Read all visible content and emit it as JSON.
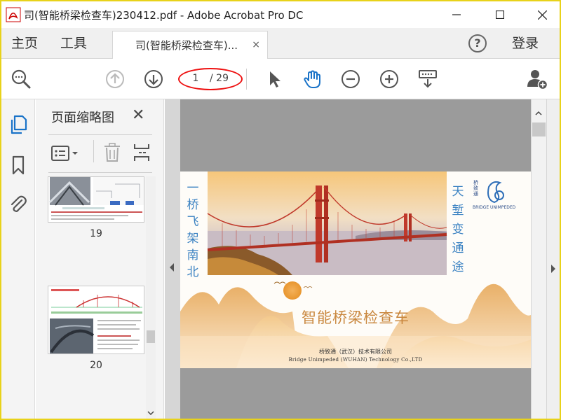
{
  "window": {
    "title": "司(智能桥梁检查车)230412.pdf - Adobe Acrobat Pro DC",
    "minimize_icon": "minimize-icon",
    "maximize_icon": "maximize-icon",
    "close_icon": "close-icon"
  },
  "tabs": {
    "home_label": "主页",
    "tools_label": "工具",
    "document_tab_label": "司(智能桥梁检查车)...",
    "document_tab_close": "×",
    "help_label": "?",
    "login_label": "登录"
  },
  "toolbar": {
    "page_current": "1",
    "page_total": "/ 29",
    "icons": [
      "zoom-search-icon",
      "page-up-icon",
      "page-down-icon",
      "select-cursor-icon",
      "hand-tool-icon",
      "zoom-out-icon",
      "zoom-in-icon",
      "read-mode-icon",
      "add-user-icon"
    ]
  },
  "left_rail": {
    "icons": [
      "page-thumbnails-icon",
      "bookmark-icon",
      "attachment-icon"
    ]
  },
  "thumbnail_panel": {
    "title": "页面缩略图",
    "close": "✕",
    "thumbnails": [
      {
        "page_label": "19"
      },
      {
        "page_label": "20"
      }
    ]
  },
  "document": {
    "vertical_left": [
      "一",
      "桥",
      "飞",
      "架",
      "南",
      "北"
    ],
    "vertical_right": [
      "天",
      "堑",
      "变",
      "通",
      "途"
    ],
    "headline": "智能桥梁检查车",
    "company_cn": "桥致通（武汉）技术有限公司",
    "company_en": "Bridge Unimpeded  (WUHAN) Technology Co.,LTD",
    "logo_cn": [
      "桥",
      "致",
      "通"
    ],
    "logo_en": "BRIDGE UNIMPEDED"
  },
  "colors": {
    "accent_blue": "#3b82c2",
    "highlight_red": "#e11111",
    "headline_gold": "#c9873e",
    "frame_yellow": "#e8d21a"
  }
}
